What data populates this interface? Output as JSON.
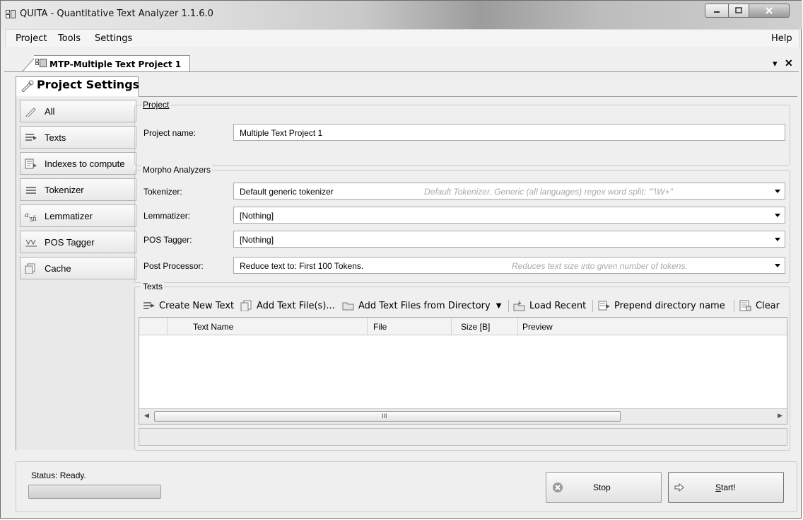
{
  "window": {
    "title": "QUITA - Quantitative Text Analyzer 1.1.6.0"
  },
  "menubar": {
    "items": [
      "Project",
      "Tools",
      "Settings"
    ],
    "help": "Help"
  },
  "doc_tab": {
    "label": "MTP-Multiple Text Project 1",
    "menu_glyph": "▾",
    "close_glyph": "✕"
  },
  "settings_tab": {
    "label": "Project Settings"
  },
  "nav": {
    "items": [
      {
        "label": "All",
        "icon": "pencil-icon"
      },
      {
        "label": "Texts",
        "icon": "texts-icon"
      },
      {
        "label": "Indexes to compute",
        "icon": "indexes-icon"
      },
      {
        "label": "Tokenizer",
        "icon": "tokenizer-icon"
      },
      {
        "label": "Lemmatizer",
        "icon": "lemmatizer-icon"
      },
      {
        "label": "POS Tagger",
        "icon": "pos-tagger-icon"
      },
      {
        "label": "Cache",
        "icon": "cache-icon"
      }
    ]
  },
  "project_group": {
    "title": "Project",
    "name_label": "Project name:",
    "name_value": "Multiple Text Project 1"
  },
  "morpho_group": {
    "title": "Morpho Analyzers",
    "tokenizer_label": "Tokenizer:",
    "tokenizer_value": "Default generic tokenizer",
    "tokenizer_hint": "Default Tokenizer. Generic (all languages) regex word split: \"\"\\W+\"",
    "lemmatizer_label": "Lemmatizer:",
    "lemmatizer_value": "[Nothing]",
    "pos_label": "POS Tagger:",
    "pos_value": "[Nothing]",
    "post_label": "Post Processor:",
    "post_value": "Reduce text to: First 100 Tokens.",
    "post_hint": "Reduces text size into given number of tokens."
  },
  "texts_group": {
    "title": "Texts",
    "toolbar": {
      "create_new": "Create New Text",
      "add_files": "Add Text File(s)...",
      "add_dir": "Add Text Files from Directory",
      "load_recent": "Load Recent",
      "prepend": "Prepend directory name",
      "clear": "Clear"
    },
    "columns": [
      "Text Name",
      "File",
      "Size [B]",
      "Preview"
    ],
    "rows": [],
    "scroll_glyph": "III"
  },
  "status": {
    "text": "Status: Ready.",
    "progress": 0
  },
  "buttons": {
    "stop": "Stop",
    "start_prefix": "S",
    "start_rest": "tart!"
  },
  "colors": {
    "window_bg": "#efefef",
    "field_border": "#a9a9a9",
    "hint_text": "#a9a9a9"
  }
}
